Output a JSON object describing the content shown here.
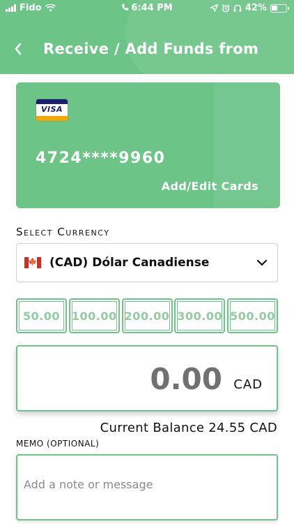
{
  "status_bar": {
    "carrier": "Fido",
    "time": "6:44 PM",
    "battery": "42%"
  },
  "header": {
    "title": "Receive / Add Funds from",
    "back_icon": "chevron-left-icon"
  },
  "card": {
    "brand": "VISA",
    "number": "4724****9960",
    "add_edit_label": "Add/Edit Cards"
  },
  "currency": {
    "label": "Select Currency",
    "selected": "(CAD) Dólar Canadiense",
    "flag_icon": "canada-flag-icon"
  },
  "amount_options": [
    "50.00",
    "100.00",
    "200.00",
    "300.00",
    "500.00"
  ],
  "amount": {
    "value": "0.00",
    "currency": "CAD"
  },
  "balance": "Current Balance 24.55 CAD",
  "memo": {
    "label": "MEMO (OPTIONAL)",
    "placeholder": "Add a note or message"
  },
  "colors": {
    "accent": "#6cc487",
    "amount_text": "#8fcc9f"
  }
}
